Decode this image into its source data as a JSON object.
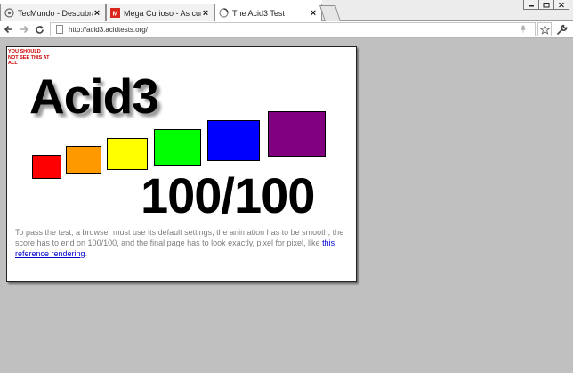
{
  "tabs": [
    {
      "title": "TecMundo - Descubra",
      "favicon": "tecmundo-favicon",
      "active": false
    },
    {
      "title": "Mega Curioso - As curi",
      "favicon": "megacurioso-favicon",
      "active": false
    },
    {
      "title": "The Acid3 Test",
      "favicon": "loading-favicon",
      "active": true
    }
  ],
  "toolbar": {
    "url": "http://acid3.acidtests.org/",
    "back_icon": "back-arrow-icon",
    "forward_icon": "forward-arrow-icon",
    "reload_icon": "reload-icon",
    "star_icon": "bookmark-star-icon",
    "menu_icon": "wrench-menu-icon"
  },
  "page": {
    "warning": "YOU SHOULD NOT SEE THIS AT ALL",
    "heading": "Acid3",
    "score": "100/100",
    "description": "To pass the test, a browser must use its default settings, the animation has to be smooth, the score has to end on 100/100, and the final page has to look exactly, pixel for pixel, like",
    "link_text": "this reference rendering",
    "link_suffix": ".",
    "boxes": [
      {
        "name": "box-red",
        "color": "#ff0000"
      },
      {
        "name": "box-orange",
        "color": "#ff9900"
      },
      {
        "name": "box-yellow",
        "color": "#ffff00"
      },
      {
        "name": "box-green",
        "color": "#00ff00"
      },
      {
        "name": "box-blue",
        "color": "#0000ff"
      },
      {
        "name": "box-purple",
        "color": "#800080"
      }
    ]
  }
}
